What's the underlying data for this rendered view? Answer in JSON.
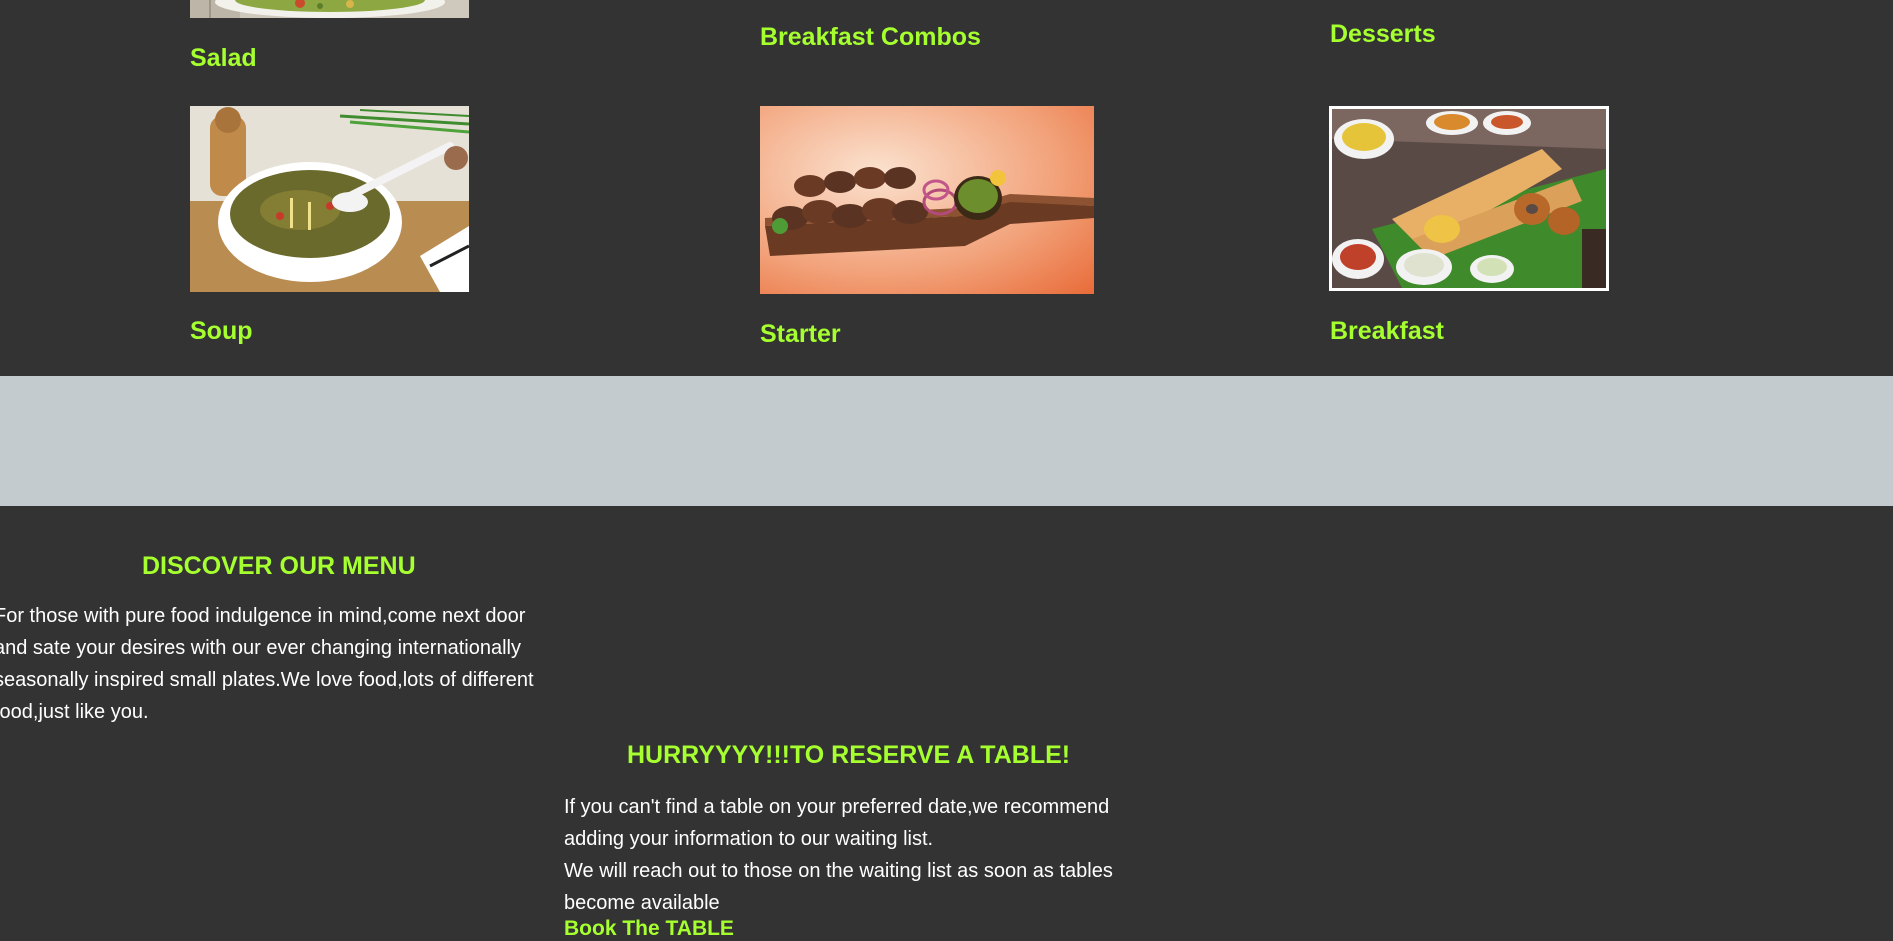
{
  "menu_grid": {
    "row1": [
      {
        "title": "Salad",
        "image": "salad-photo"
      },
      {
        "title": "Breakfast Combos",
        "image": "breakfast-combos-photo"
      },
      {
        "title": "Desserts",
        "image": "desserts-photo"
      }
    ],
    "row2": [
      {
        "title": "Soup",
        "image": "soup-photo"
      },
      {
        "title": "Starter",
        "image": "starter-photo"
      },
      {
        "title": "Breakfast",
        "image": "breakfast-photo"
      }
    ]
  },
  "discover": {
    "heading": "DISCOVER OUR MENU",
    "text": "For those with pure food indulgence in mind,come next door and sate your desires with our ever changing internationally seasonally inspired small plates.We love food,lots of different food,just like you."
  },
  "reserve": {
    "heading": "HURRYYYY!!!TO RESERVE A TABLE!",
    "text1": "If you can't find a table on your preferred date,we recommend adding your information to our waiting list.",
    "text2": "We will reach out to those on the waiting list as soon as tables become available",
    "link": "Book The TABLE"
  },
  "colors": {
    "background": "#333333",
    "accent": "#a6ff2e",
    "band": "#c3cbce",
    "text": "#ffffff"
  }
}
